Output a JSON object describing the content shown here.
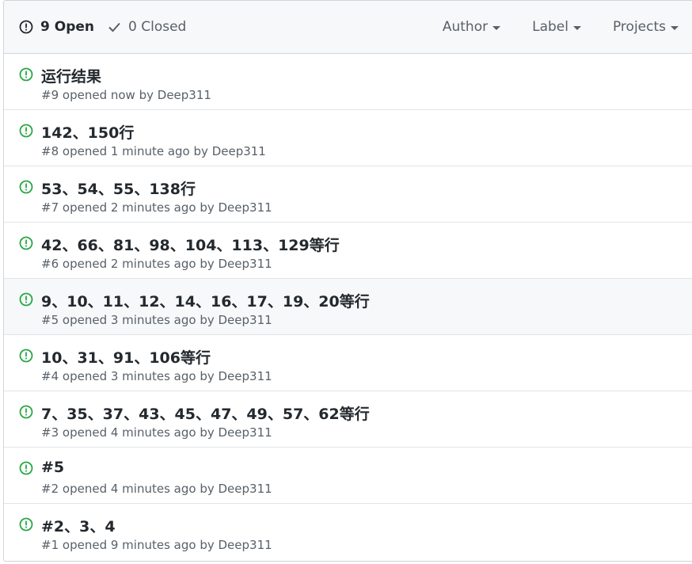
{
  "header": {
    "open_label": "9 Open",
    "closed_label": "0 Closed",
    "filters": [
      "Author",
      "Label",
      "Projects"
    ]
  },
  "colors": {
    "open_icon": "#28a745",
    "text": "#24292e",
    "muted": "#586069"
  },
  "issues": [
    {
      "title": "运行结果",
      "number": "#9",
      "opened": "opened now by",
      "author": "Deep311"
    },
    {
      "title": "142、150行",
      "number": "#8",
      "opened": "opened 1 minute ago by",
      "author": "Deep311"
    },
    {
      "title": "53、54、55、138行",
      "number": "#7",
      "opened": "opened 2 minutes ago by",
      "author": "Deep311"
    },
    {
      "title": "42、66、81、98、104、113、129等行",
      "number": "#6",
      "opened": "opened 2 minutes ago by",
      "author": "Deep311"
    },
    {
      "title": "9、10、11、12、14、16、17、19、20等行",
      "number": "#5",
      "opened": "opened 3 minutes ago by",
      "author": "Deep311"
    },
    {
      "title": "10、31、91、106等行",
      "number": "#4",
      "opened": "opened 3 minutes ago by",
      "author": "Deep311"
    },
    {
      "title": "7、35、37、43、45、47、49、57、62等行",
      "number": "#3",
      "opened": "opened 4 minutes ago by",
      "author": "Deep311"
    },
    {
      "title": "#5",
      "number": "#2",
      "opened": "opened 4 minutes ago by",
      "author": "Deep311"
    },
    {
      "title": "#2、3、4",
      "number": "#1",
      "opened": "opened 9 minutes ago by",
      "author": "Deep311"
    }
  ]
}
